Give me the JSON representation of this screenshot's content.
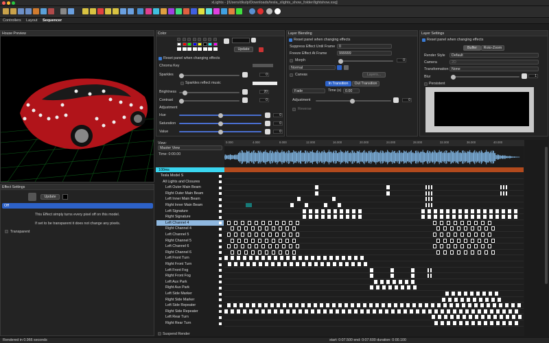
{
  "window": {
    "title": "xLights - [/Users/dkulp/Downloads/tesla_xlights_show_folder/lightshow.xsq]"
  },
  "tabs": [
    "Controllers",
    "Layout",
    "Sequencer"
  ],
  "house_preview": {
    "title": "House Preview"
  },
  "color_panel": {
    "title": "Color",
    "reset_label": "Reset panel when changing effects",
    "chroma_key": "Chroma Key",
    "sparkles": "Sparkles",
    "sparkles_value": "0",
    "sparkles_reflect": "Sparkles reflect music",
    "brightness": "Brightness",
    "brightness_value": "20",
    "contrast": "Contrast",
    "contrast_value": "0",
    "adjustment": "Adjustment",
    "hue": "Hue",
    "hue_value": "0",
    "saturation": "Saturation",
    "saturation_value": "0",
    "value": "Value",
    "value_value": "0",
    "update": "Update",
    "palette": [
      "#ffffff",
      "#ff0000",
      "#00ff00",
      "#0000ff",
      "#ffff00",
      "#000000",
      "#00ffff",
      "#ff00ff"
    ]
  },
  "layer_blending": {
    "title": "Layer Blending",
    "reset_label": "Reset panel when changing effects",
    "suppress_label": "Suppress Effect Until Frame",
    "suppress_value": "0",
    "freeze_label": "Freeze Effect At Frame",
    "freeze_value": "999999",
    "morph": "Morph",
    "morph_value": "0",
    "blend_mode": "Normal",
    "canvas": "Canvas",
    "layers_button": "Layers...",
    "in_transition": "In Transition",
    "out_transition": "Out Transition",
    "fade": "Fade",
    "time_label": "Time (s)",
    "time_value": "0.00",
    "adjustment": "Adjustment",
    "adjustment_value": "0",
    "reverse": "Reverse"
  },
  "layer_settings": {
    "title": "Layer Settings",
    "reset_label": "Reset panel when changing effects",
    "tab_buffer": "Buffer",
    "tab_roto": "Roto-Zoom",
    "render_style": "Render Style",
    "render_style_value": "Default",
    "camera": "Camera",
    "camera_value": "2D",
    "transformation": "Transformation",
    "transformation_value": "None",
    "blur": "Blur",
    "blur_value": "1",
    "persistent": "Persistent"
  },
  "viewer": {
    "label": "View:",
    "value": "Master View",
    "time": "Time: 0:00.00",
    "timing_track": "100ms"
  },
  "rows": [
    "Tesla Model S",
    "All Lights and Closures",
    "Left Outer Main Beam",
    "Right Outer Main Beam",
    "Left Inner Main Beam",
    "Right Inner Main Beam",
    "Left Signature",
    "Right Signature",
    "Left Channel 4",
    "Right Channel 4",
    "Left Channel 5",
    "Right Channel 5",
    "Left Channel 6",
    "Right Channel 6",
    "Left Front Turn",
    "Right Front Turn",
    "Left Front Fog",
    "Right Front Fog",
    "Left Aux Park",
    "Right Aux Park",
    "Left Side Marker",
    "Right Side Marker",
    "Left Side Repeater",
    "Right Side Repeater",
    "Left Rear Turn",
    "Right Rear Turn"
  ],
  "ruler": [
    "0.000",
    "4.000",
    "8.000",
    "12.000",
    "16.000",
    "20.000",
    "24.000",
    "28.000",
    "32.000",
    "36.000",
    "40.000"
  ],
  "effect_settings": {
    "title": "Effect Settings",
    "update": "Update",
    "effect": "Off",
    "desc1": "This Effect simply turns every pixel off on this model.",
    "desc2": "If set to be transparent it does not change any pixels.",
    "transparent": "Transparent"
  },
  "status": {
    "left": "Rendered in    0.966 seconds",
    "right": "start: 0:07.500  end: 0:07.600  duration: 0:00.100",
    "suspend": "Suspend Render"
  }
}
